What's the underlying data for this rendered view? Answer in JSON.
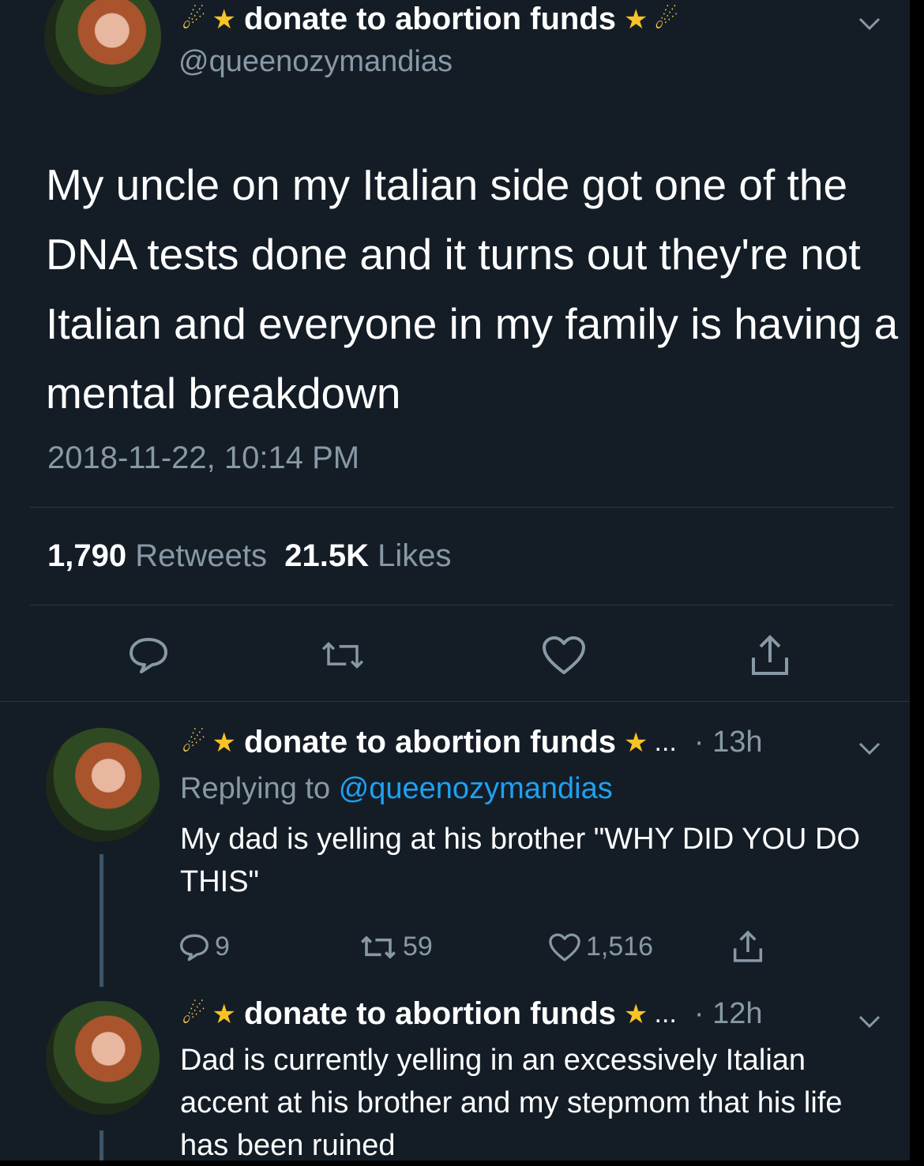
{
  "main_tweet": {
    "display_name": "donate to abortion funds",
    "handle": "@queenozymandias",
    "text": "My uncle on my Italian side got one of the DNA tests done and it turns out they're not Italian and everyone in my family is having a mental breakdown",
    "timestamp": "2018-11-22, 10:14 PM",
    "retweets_count": "1,790",
    "retweets_label": "Retweets",
    "likes_count": "21.5K",
    "likes_label": "Likes"
  },
  "replies": [
    {
      "display_name": "donate to abortion funds",
      "ellipsis": "...",
      "time": "· 13h",
      "replying_label": "Replying to",
      "replying_to": "@queenozymandias",
      "text": "My dad is yelling at his brother \"WHY DID YOU DO THIS\"",
      "replies_count": "9",
      "retweets_count": "59",
      "likes_count": "1,516"
    },
    {
      "display_name": "donate to abortion funds",
      "ellipsis": "...",
      "time": "· 12h",
      "text": "Dad is currently yelling in an excessively Italian accent at his brother and my stepmom that his life has been ruined"
    }
  ],
  "icons": {
    "name_decorations": [
      "comet-emoji",
      "star-emoji"
    ],
    "actions": [
      "reply-icon",
      "retweet-icon",
      "like-icon",
      "share-icon"
    ],
    "menu": "chevron-down-icon"
  },
  "colors": {
    "background": "#141d26",
    "text_primary": "#ffffff",
    "text_secondary": "#8899a6",
    "link": "#1da1f2",
    "divider": "#2a3540"
  }
}
